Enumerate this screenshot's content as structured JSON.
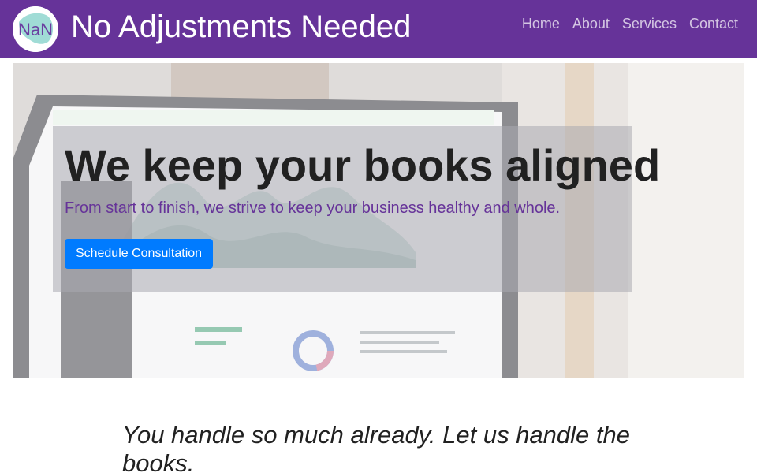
{
  "navbar": {
    "logo_text": "NaN",
    "brand": "No Adjustments Needed",
    "links": [
      "Home",
      "About",
      "Services",
      "Contact"
    ]
  },
  "hero": {
    "title": "We keep your books aligned",
    "subtitle": "From start to finish, we strive to keep your business healthy and whole.",
    "cta_label": "Schedule Consultation"
  },
  "tagline": "You handle so much already. Let us handle the books.",
  "colors": {
    "navbar_bg": "#663399",
    "cta_bg": "#007bff",
    "subtitle_text": "#663399"
  }
}
